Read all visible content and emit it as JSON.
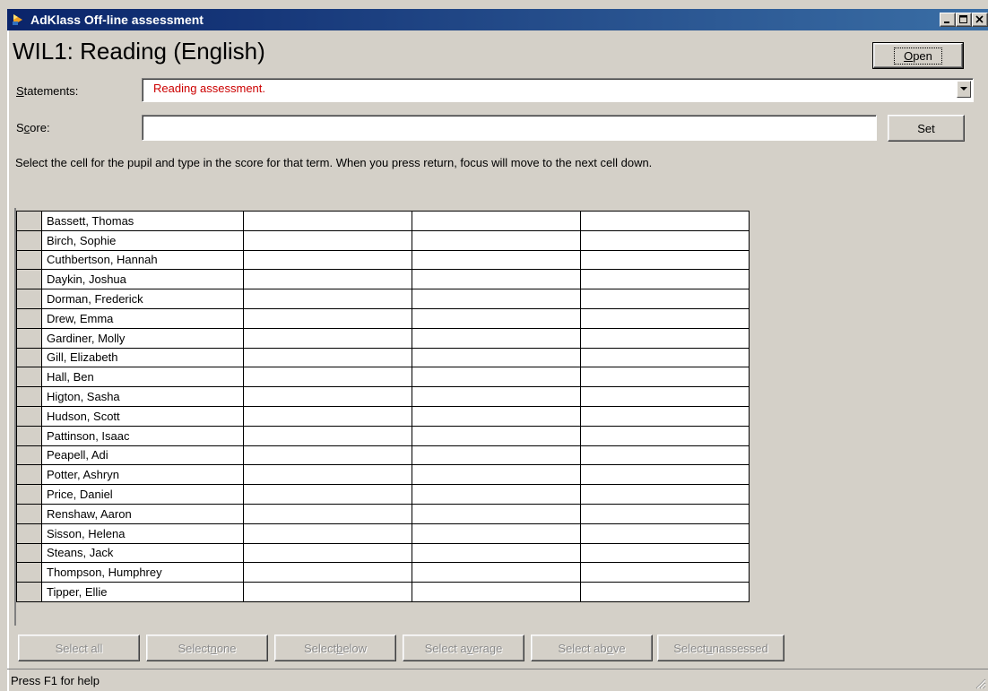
{
  "window": {
    "title": "AdKlass Off-line assessment",
    "minimize": "_",
    "maximize": "□",
    "close": "×"
  },
  "header": {
    "title": "WIL1: Reading (English)",
    "open_button": "Open"
  },
  "statements": {
    "label_prefix": "S",
    "label_rest": "tatements:",
    "selected": "Reading assessment."
  },
  "score": {
    "label_prefix": "S",
    "label_u": "c",
    "label_rest": "ore:",
    "value": "",
    "set_button": "Set"
  },
  "instructions": "Select the cell for the pupil and type in the score for that term.  When you press return, focus will move to the next cell down.",
  "pupils": [
    "Bassett, Thomas",
    "Birch, Sophie",
    "Cuthbertson, Hannah",
    "Daykin, Joshua",
    "Dorman, Frederick",
    "Drew, Emma",
    "Gardiner, Molly",
    "Gill, Elizabeth",
    "Hall, Ben",
    "Higton, Sasha",
    "Hudson, Scott",
    "Pattinson, Isaac",
    "Peapell, Adi",
    "Potter, Ashryn",
    "Price, Daniel",
    "Renshaw, Aaron",
    "Sisson, Helena",
    "Steans, Jack",
    "Thompson, Humphrey",
    "Tipper, Ellie"
  ],
  "select_buttons": {
    "all": "Select all",
    "none_pre": "Select ",
    "none_u": "n",
    "none_post": "one",
    "below_pre": "Select ",
    "below_u": "b",
    "below_post": "elow",
    "average_pre": "Select a",
    "average_u": "v",
    "average_post": "erage",
    "above_pre": "Select ab",
    "above_u": "o",
    "above_post": "ve",
    "unassessed_pre": "Select ",
    "unassessed_u": "u",
    "unassessed_post": "nassessed"
  },
  "status": {
    "text": "Press F1 for help"
  },
  "colors": {
    "titlebar_start": "#0a246a",
    "titlebar_end": "#3a6ea5",
    "statement_text": "#cc0000",
    "face": "#d4d0c8"
  }
}
